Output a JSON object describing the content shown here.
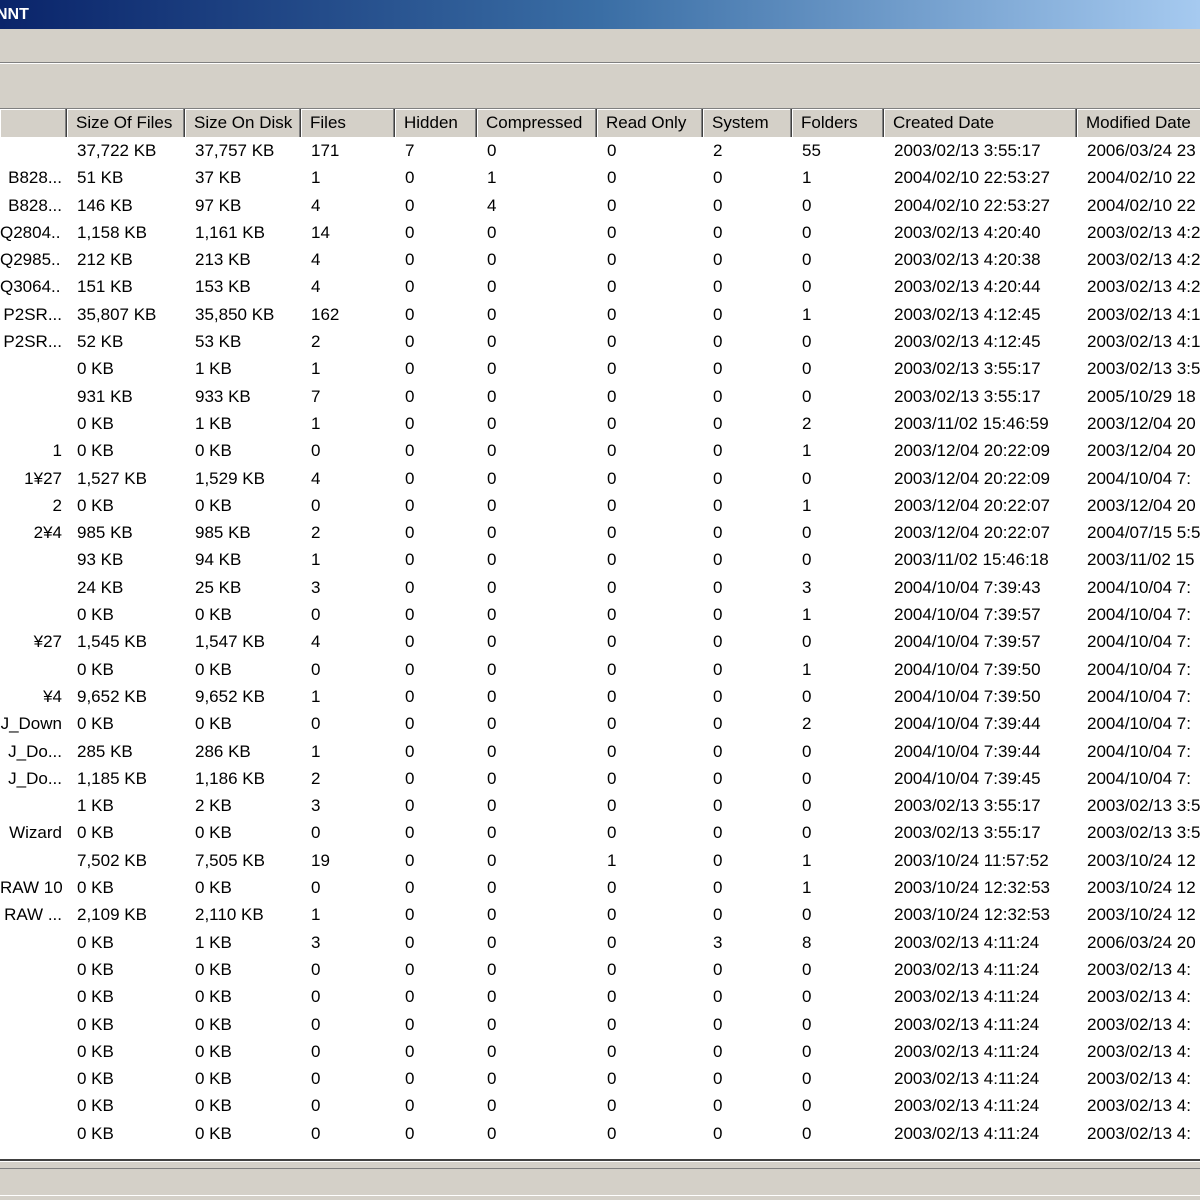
{
  "window": {
    "title": "NNT"
  },
  "columns": [
    {
      "key": "name",
      "label": ""
    },
    {
      "key": "size_files",
      "label": "Size Of Files"
    },
    {
      "key": "size_disk",
      "label": "Size On Disk"
    },
    {
      "key": "files",
      "label": "Files"
    },
    {
      "key": "hidden",
      "label": "Hidden"
    },
    {
      "key": "compressed",
      "label": "Compressed"
    },
    {
      "key": "read_only",
      "label": "Read Only"
    },
    {
      "key": "system",
      "label": "System"
    },
    {
      "key": "folders",
      "label": "Folders"
    },
    {
      "key": "created",
      "label": "Created Date"
    },
    {
      "key": "modified",
      "label": "Modified Date"
    }
  ],
  "rows": [
    [
      "",
      "37,722 KB",
      "37,757 KB",
      "171",
      "7",
      "0",
      "0",
      "2",
      "55",
      "2003/02/13 3:55:17",
      "2006/03/24 23"
    ],
    [
      "B828...",
      "51 KB",
      "37 KB",
      "1",
      "0",
      "1",
      "0",
      "0",
      "1",
      "2004/02/10 22:53:27",
      "2004/02/10 22"
    ],
    [
      "B828...",
      "146 KB",
      "97 KB",
      "4",
      "0",
      "4",
      "0",
      "0",
      "0",
      "2004/02/10 22:53:27",
      "2004/02/10 22"
    ],
    [
      "Q2804...",
      "1,158 KB",
      "1,161 KB",
      "14",
      "0",
      "0",
      "0",
      "0",
      "0",
      "2003/02/13 4:20:40",
      "2003/02/13 4:2"
    ],
    [
      "Q2985...",
      "212 KB",
      "213 KB",
      "4",
      "0",
      "0",
      "0",
      "0",
      "0",
      "2003/02/13 4:20:38",
      "2003/02/13 4:2"
    ],
    [
      "Q3064...",
      "151 KB",
      "153 KB",
      "4",
      "0",
      "0",
      "0",
      "0",
      "0",
      "2003/02/13 4:20:44",
      "2003/02/13 4:2"
    ],
    [
      "P2SR...",
      "35,807 KB",
      "35,850 KB",
      "162",
      "0",
      "0",
      "0",
      "0",
      "1",
      "2003/02/13 4:12:45",
      "2003/02/13 4:1"
    ],
    [
      "P2SR...",
      "52 KB",
      "53 KB",
      "2",
      "0",
      "0",
      "0",
      "0",
      "0",
      "2003/02/13 4:12:45",
      "2003/02/13 4:1"
    ],
    [
      "",
      "0 KB",
      "1 KB",
      "1",
      "0",
      "0",
      "0",
      "0",
      "0",
      "2003/02/13 3:55:17",
      "2003/02/13 3:5"
    ],
    [
      "",
      "931 KB",
      "933 KB",
      "7",
      "0",
      "0",
      "0",
      "0",
      "0",
      "2003/02/13 3:55:17",
      "2005/10/29 18"
    ],
    [
      "",
      "0 KB",
      "1 KB",
      "1",
      "0",
      "0",
      "0",
      "0",
      "2",
      "2003/11/02 15:46:59",
      "2003/12/04 20"
    ],
    [
      "1",
      "0 KB",
      "0 KB",
      "0",
      "0",
      "0",
      "0",
      "0",
      "1",
      "2003/12/04 20:22:09",
      "2003/12/04 20"
    ],
    [
      "1¥27",
      "1,527 KB",
      "1,529 KB",
      "4",
      "0",
      "0",
      "0",
      "0",
      "0",
      "2003/12/04 20:22:09",
      "2004/10/04 7:"
    ],
    [
      "2",
      "0 KB",
      "0 KB",
      "0",
      "0",
      "0",
      "0",
      "0",
      "1",
      "2003/12/04 20:22:07",
      "2003/12/04 20"
    ],
    [
      "2¥4",
      "985 KB",
      "985 KB",
      "2",
      "0",
      "0",
      "0",
      "0",
      "0",
      "2003/12/04 20:22:07",
      "2004/07/15 5:5"
    ],
    [
      "",
      "93 KB",
      "94 KB",
      "1",
      "0",
      "0",
      "0",
      "0",
      "0",
      "2003/11/02 15:46:18",
      "2003/11/02 15"
    ],
    [
      "",
      "24 KB",
      "25 KB",
      "3",
      "0",
      "0",
      "0",
      "0",
      "3",
      "2004/10/04 7:39:43",
      "2004/10/04 7:"
    ],
    [
      "",
      "0 KB",
      "0 KB",
      "0",
      "0",
      "0",
      "0",
      "0",
      "1",
      "2004/10/04 7:39:57",
      "2004/10/04 7:"
    ],
    [
      "¥27",
      "1,545 KB",
      "1,547 KB",
      "4",
      "0",
      "0",
      "0",
      "0",
      "0",
      "2004/10/04 7:39:57",
      "2004/10/04 7:"
    ],
    [
      "",
      "0 KB",
      "0 KB",
      "0",
      "0",
      "0",
      "0",
      "0",
      "1",
      "2004/10/04 7:39:50",
      "2004/10/04 7:"
    ],
    [
      "¥4",
      "9,652 KB",
      "9,652 KB",
      "1",
      "0",
      "0",
      "0",
      "0",
      "0",
      "2004/10/04 7:39:50",
      "2004/10/04 7:"
    ],
    [
      "J_Down",
      "0 KB",
      "0 KB",
      "0",
      "0",
      "0",
      "0",
      "0",
      "2",
      "2004/10/04 7:39:44",
      "2004/10/04 7:"
    ],
    [
      "J_Do...",
      "285 KB",
      "286 KB",
      "1",
      "0",
      "0",
      "0",
      "0",
      "0",
      "2004/10/04 7:39:44",
      "2004/10/04 7:"
    ],
    [
      "J_Do...",
      "1,185 KB",
      "1,186 KB",
      "2",
      "0",
      "0",
      "0",
      "0",
      "0",
      "2004/10/04 7:39:45",
      "2004/10/04 7:"
    ],
    [
      "",
      "1 KB",
      "2 KB",
      "3",
      "0",
      "0",
      "0",
      "0",
      "0",
      "2003/02/13 3:55:17",
      "2003/02/13 3:5"
    ],
    [
      "Wizard",
      "0 KB",
      "0 KB",
      "0",
      "0",
      "0",
      "0",
      "0",
      "0",
      "2003/02/13 3:55:17",
      "2003/02/13 3:5"
    ],
    [
      "",
      "7,502 KB",
      "7,505 KB",
      "19",
      "0",
      "0",
      "1",
      "0",
      "1",
      "2003/10/24 11:57:52",
      "2003/10/24 12"
    ],
    [
      "RAW 10",
      "0 KB",
      "0 KB",
      "0",
      "0",
      "0",
      "0",
      "0",
      "1",
      "2003/10/24 12:32:53",
      "2003/10/24 12"
    ],
    [
      "RAW ...",
      "2,109 KB",
      "2,110 KB",
      "1",
      "0",
      "0",
      "0",
      "0",
      "0",
      "2003/10/24 12:32:53",
      "2003/10/24 12"
    ],
    [
      "",
      "0 KB",
      "1 KB",
      "3",
      "0",
      "0",
      "0",
      "3",
      "8",
      "2003/02/13 4:11:24",
      "2006/03/24 20"
    ],
    [
      "",
      "0 KB",
      "0 KB",
      "0",
      "0",
      "0",
      "0",
      "0",
      "0",
      "2003/02/13 4:11:24",
      "2003/02/13 4:"
    ],
    [
      "",
      "0 KB",
      "0 KB",
      "0",
      "0",
      "0",
      "0",
      "0",
      "0",
      "2003/02/13 4:11:24",
      "2003/02/13 4:"
    ],
    [
      "",
      "0 KB",
      "0 KB",
      "0",
      "0",
      "0",
      "0",
      "0",
      "0",
      "2003/02/13 4:11:24",
      "2003/02/13 4:"
    ],
    [
      "",
      "0 KB",
      "0 KB",
      "0",
      "0",
      "0",
      "0",
      "0",
      "0",
      "2003/02/13 4:11:24",
      "2003/02/13 4:"
    ],
    [
      "",
      "0 KB",
      "0 KB",
      "0",
      "0",
      "0",
      "0",
      "0",
      "0",
      "2003/02/13 4:11:24",
      "2003/02/13 4:"
    ],
    [
      "",
      "0 KB",
      "0 KB",
      "0",
      "0",
      "0",
      "0",
      "0",
      "0",
      "2003/02/13 4:11:24",
      "2003/02/13 4:"
    ],
    [
      "",
      "0 KB",
      "0 KB",
      "0",
      "0",
      "0",
      "0",
      "0",
      "0",
      "2003/02/13 4:11:24",
      "2003/02/13 4:"
    ]
  ]
}
